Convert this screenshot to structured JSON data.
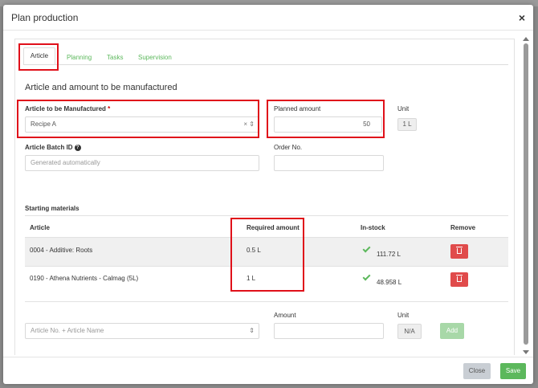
{
  "modal": {
    "title": "Plan production",
    "close": "×"
  },
  "tabs": [
    "Article",
    "Planning",
    "Tasks",
    "Supervision"
  ],
  "form": {
    "section_title": "Article and amount to be manufactured",
    "article_label": "Article to be Manufactured",
    "required_marker": "*",
    "article_value": "Recipe A",
    "planned_label": "Planned amount",
    "planned_value": "50",
    "unit_label": "Unit",
    "unit_value": "1 L",
    "batch_label": "Article Batch ID",
    "batch_placeholder": "Generated automatically",
    "order_label": "Order No."
  },
  "materials": {
    "title": "Starting materials",
    "headers": [
      "Article",
      "Required amount",
      "In-stock",
      "Remove"
    ],
    "rows": [
      {
        "article": "0004 - Additive: Roots",
        "required": "0.5 L",
        "stock": "111.72 L"
      },
      {
        "article": "0190 - Athena Nutrients - Calmag (5L)",
        "required": "1 L",
        "stock": "48.958 L"
      }
    ]
  },
  "add_row": {
    "amount_label": "Amount",
    "unit_label": "Unit",
    "article_placeholder": "Article No. + Article Name",
    "unit_value": "N/A",
    "add_button": "Add"
  },
  "footer": {
    "close_button": "Close",
    "save_button": "Save"
  },
  "colors": {
    "accent_green": "#5cb85c",
    "delete_red": "#e04b4b",
    "highlight_red": "#e0101a"
  }
}
